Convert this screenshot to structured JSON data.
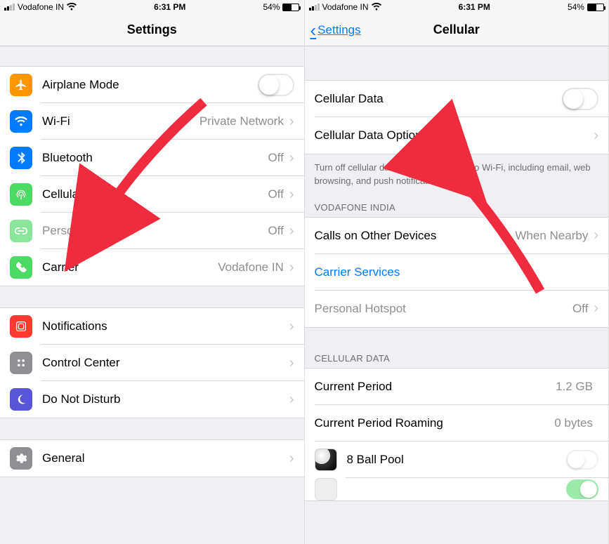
{
  "status": {
    "carrier": "Vodafone IN",
    "time": "6:31 PM",
    "battery": "54%"
  },
  "left": {
    "title": "Settings",
    "rows": {
      "airplane": "Airplane Mode",
      "wifi": "Wi-Fi",
      "wifi_detail": "Private Network",
      "bluetooth": "Bluetooth",
      "bluetooth_detail": "Off",
      "cellular": "Cellular",
      "cellular_detail": "Off",
      "hotspot": "Personal Hotspot",
      "hotspot_detail": "Off",
      "carrier": "Carrier",
      "carrier_detail": "Vodafone IN",
      "notifications": "Notifications",
      "control_center": "Control Center",
      "dnd": "Do Not Disturb",
      "general": "General"
    }
  },
  "right": {
    "back": "Settings",
    "title": "Cellular",
    "rows": {
      "cellular_data": "Cellular Data",
      "cellular_data_options": "Cellular Data Options",
      "footer": "Turn off cellular data to restrict all data to Wi-Fi, including email, web browsing, and push notifications.",
      "section_carrier": "VODAFONE INDIA",
      "calls_other": "Calls on Other Devices",
      "calls_other_detail": "When Nearby",
      "carrier_services": "Carrier Services",
      "hotspot": "Personal Hotspot",
      "hotspot_detail": "Off",
      "section_data": "CELLULAR DATA",
      "current_period": "Current Period",
      "current_period_val": "1.2 GB",
      "roaming": "Current Period Roaming",
      "roaming_val": "0 bytes",
      "app_8ball": "8 Ball Pool"
    }
  }
}
